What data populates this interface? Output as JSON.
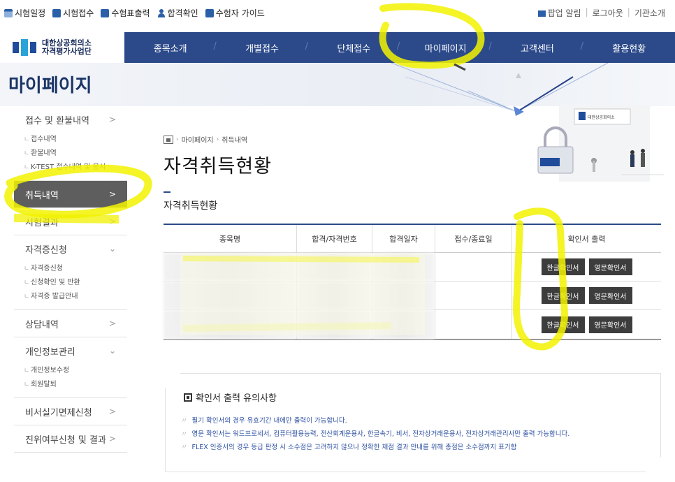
{
  "topbar": {
    "links": [
      {
        "label": "시험일정",
        "icon": "calendar-icon"
      },
      {
        "label": "시험접수",
        "icon": "edit-icon"
      },
      {
        "label": "수험표출력",
        "icon": "print-icon"
      },
      {
        "label": "합격확인",
        "icon": "person-icon"
      },
      {
        "label": "수험자 가이드",
        "icon": "book-icon"
      }
    ],
    "right": {
      "popup": "팝업 알림",
      "logout": "로그아웃",
      "org": "기관소개"
    }
  },
  "brand": {
    "line1": "대한상공회의소",
    "line2": "자격평가사업단"
  },
  "nav": {
    "items": [
      "종목소개",
      "개별접수",
      "단체접수",
      "마이페이지",
      "고객센터",
      "활용현황"
    ]
  },
  "banner": {
    "title": "마이페이지"
  },
  "sidebar": {
    "groups": [
      {
        "label": "접수 및 환불내역",
        "sub": [
          "접수내역",
          "환불내역",
          "K-TEST 접수내역 및 응시"
        ]
      },
      {
        "label": "취득내역",
        "active": true
      },
      {
        "label": "시험결과"
      },
      {
        "label": "자격증신청",
        "sub": [
          "자격증신청",
          "신청확인 및 반환",
          "자격증 발급안내"
        ]
      },
      {
        "label": "상담내역"
      },
      {
        "label": "개인정보관리",
        "sub": [
          "개인정보수정",
          "회원탈퇴"
        ]
      },
      {
        "label": "비서실기면제신청"
      },
      {
        "label": "진위여부신청 및 결과"
      }
    ]
  },
  "breadcrumb": {
    "items": [
      "마이페이지",
      "취득내역"
    ]
  },
  "page": {
    "title": "자격취득현황",
    "subtitle": "자격취득현황"
  },
  "table": {
    "headers": [
      "종목명",
      "합격/자격번호",
      "합격일자",
      "접수/종료일",
      "확인서 출력"
    ],
    "rows": [
      {
        "btn_kr": "한글확인서",
        "btn_en": "영문확인서"
      },
      {
        "btn_kr": "한글확인서",
        "btn_en": "영문확인서"
      },
      {
        "btn_kr": "한글확인서",
        "btn_en": "영문확인서"
      }
    ]
  },
  "notice": {
    "title": "확인서 출력 유의사항",
    "lines": [
      "필기 확인서의 경우 유효기간 내에만 출력이 가능합니다.",
      "영문 확인서는 워드프로세서, 컴퓨터활용능력, 전산회계운용사, 한글속기, 비서, 전자상거래운용사, 전자상거래관리사만 출력 가능합니다.",
      "FLEX 인증서의 경우 등급 판정 시 소수점은 고려하지 않으나 정확한 채점 결과 안내를 위해 총점은 소수점까지 표기함"
    ]
  },
  "colors": {
    "nav": "#2c4a8a",
    "highlight": "#f5f500",
    "button": "#3d3d3d"
  }
}
